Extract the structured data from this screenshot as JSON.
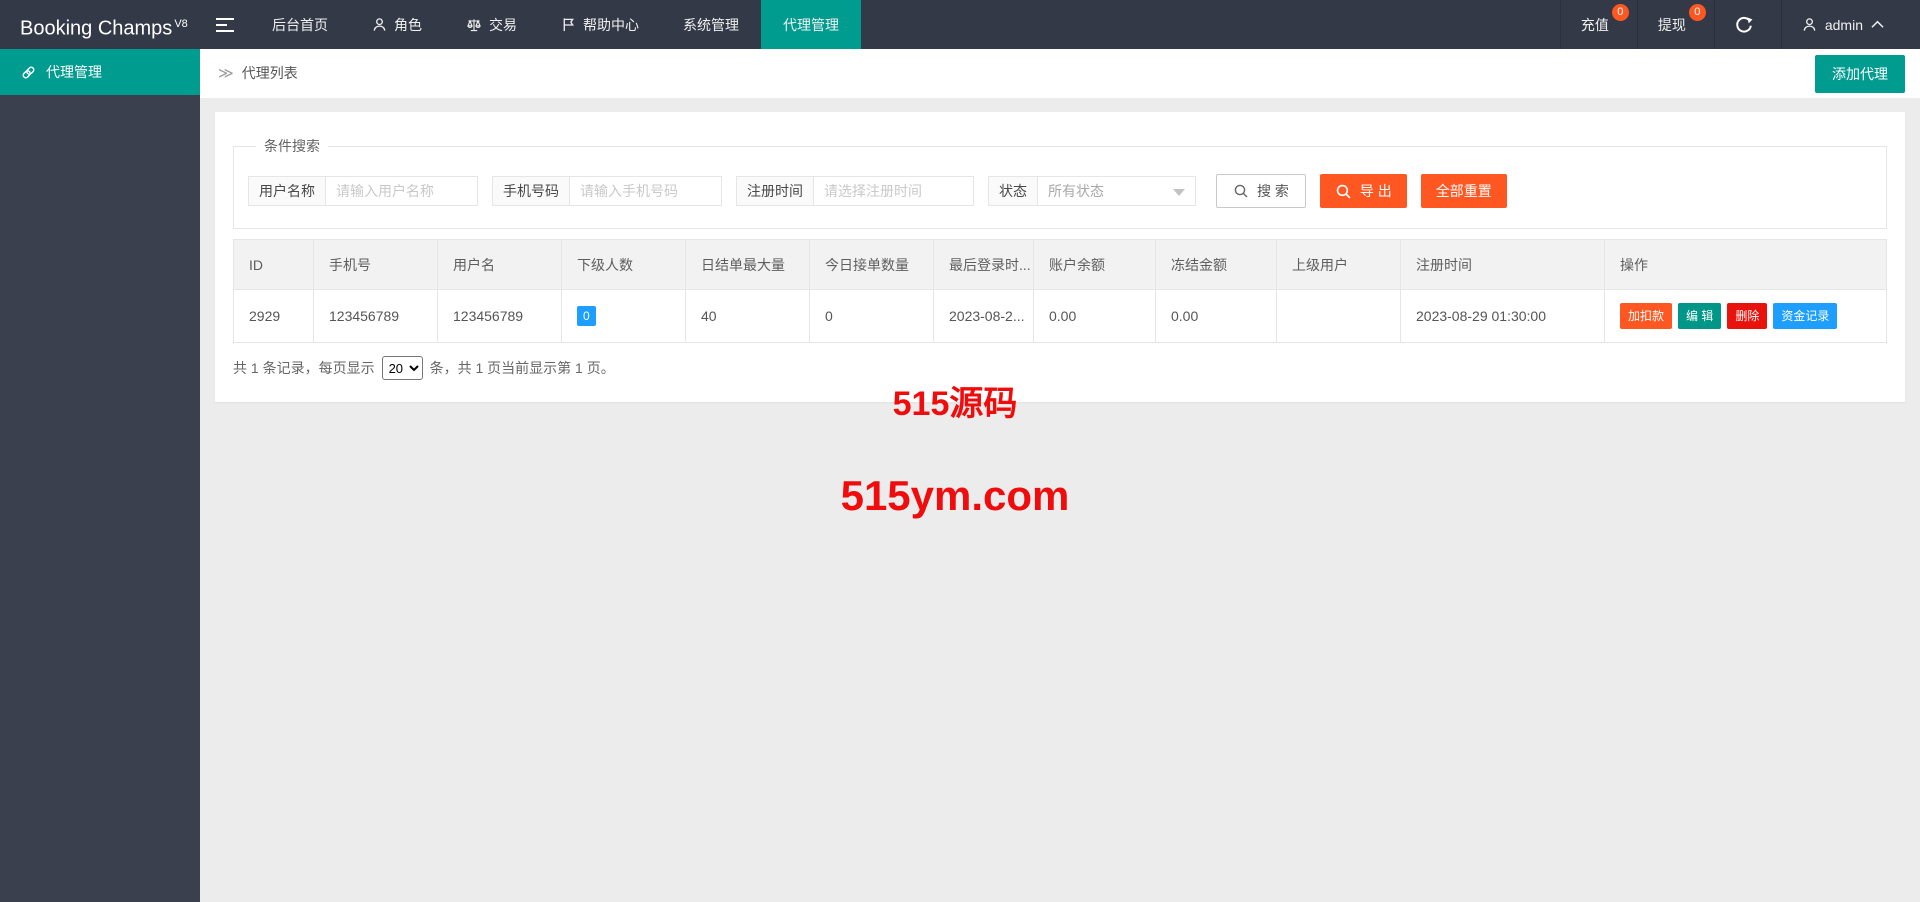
{
  "navbar": {
    "logo": {
      "text": "Booking Champs",
      "version": "V8"
    },
    "items": [
      {
        "label": "后台首页"
      },
      {
        "label": "角色",
        "icon": "user-icon"
      },
      {
        "label": "交易",
        "icon": "scales-icon"
      },
      {
        "label": "帮助中心",
        "icon": "flag-icon"
      },
      {
        "label": "系统管理"
      },
      {
        "label": "代理管理",
        "active": true
      }
    ],
    "right": [
      {
        "label": "充值",
        "badge": "0"
      },
      {
        "label": "提现",
        "badge": "0"
      }
    ],
    "admin": {
      "name": "admin"
    }
  },
  "sidebar": {
    "items": [
      {
        "label": "代理管理",
        "icon": "link-icon",
        "active": true
      }
    ]
  },
  "page": {
    "breadcrumb_arrow": "≫",
    "breadcrumb": "代理列表",
    "add_button": "添加代理"
  },
  "search": {
    "legend": "条件搜索",
    "fields": [
      {
        "label": "用户名称",
        "placeholder": "请输入用户名称"
      },
      {
        "label": "手机号码",
        "placeholder": "请输入手机号码"
      },
      {
        "label": "注册时间",
        "placeholder": "请选择注册时间"
      }
    ],
    "status": {
      "label": "状态",
      "value": "所有状态"
    },
    "buttons": {
      "search": "搜 索",
      "export": "导 出",
      "reset": "全部重置"
    }
  },
  "table": {
    "columns": [
      "ID",
      "手机号",
      "用户名",
      "下级人数",
      "日结单最大量",
      "今日接单数量",
      "最后登录时...",
      "账户余额",
      "冻结金额",
      "上级用户",
      "注册时间",
      "操作"
    ],
    "row": {
      "id": "2929",
      "phone": "123456789",
      "username": "123456789",
      "subordinates": "0",
      "daily_max": "40",
      "today_orders": "0",
      "last_login": "2023-08-2...",
      "balance": "0.00",
      "frozen": "0.00",
      "parent_user": "",
      "reg_time": "2023-08-29 01:30:00"
    },
    "actions": [
      "加扣款",
      "编 辑",
      "删除",
      "资金记录"
    ]
  },
  "pagination": {
    "prefix": "共 1 条记录，每页显示",
    "page_size": "20",
    "suffix": "条，共 1 页当前显示第 1 页。"
  },
  "watermark": {
    "line1": "515源码",
    "line2": "515ym.com"
  },
  "colors": {
    "teal": "#009c8f",
    "orange": "#ff5722",
    "green": "#009688",
    "red": "#e8130c",
    "blue": "#1e9fff",
    "navbar": "#333947",
    "sidebar": "#3a404d"
  }
}
